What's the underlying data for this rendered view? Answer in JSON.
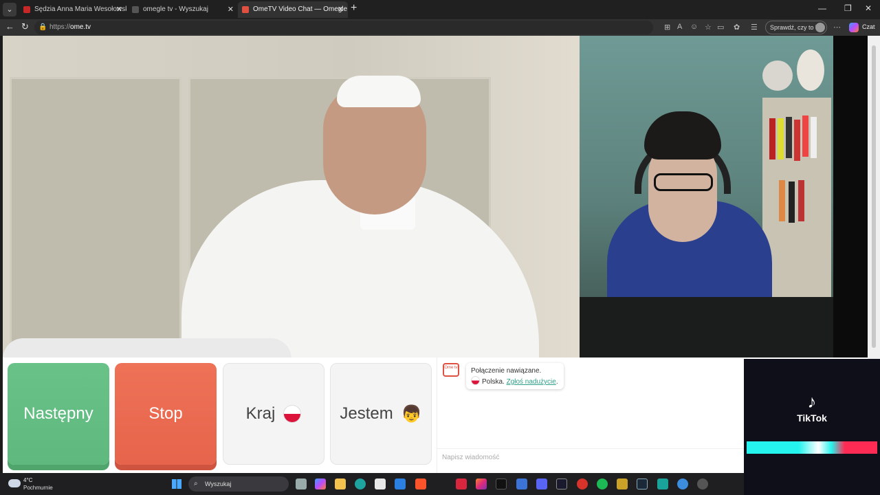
{
  "browser": {
    "tabs": [
      {
        "title": "Sędzia Anna Maria Wesołowska o",
        "active": false,
        "color": "#c62828"
      },
      {
        "title": "omegle tv - Wyszukaj",
        "active": false,
        "color": "#888888"
      },
      {
        "title": "OmeTV Video Chat — Omegle",
        "active": true,
        "color": "#e05040"
      }
    ],
    "address_prefix": "https://",
    "address_domain": "ome.tv",
    "profile_label": "Sprawdź, czy to Ty",
    "chat_label": "Czat"
  },
  "controls": {
    "next_label": "Następny",
    "stop_label": "Stop",
    "country_label": "Kraj",
    "gender_label": "Jestem",
    "next_color": "#69c288",
    "stop_color": "#ee7257"
  },
  "chat": {
    "logo_text": "Ome tv",
    "status": "Połączenie nawiązane.",
    "country": "Polska.",
    "report_link": "Zgłoś nadużycie",
    "report_suffix": ".",
    "input_placeholder": "Napisz wiadomość"
  },
  "tiktok": {
    "name": "TikTok"
  },
  "taskbar": {
    "temperature": "4°C",
    "weather": "Pochmurnie",
    "search_placeholder": "Wyszukaj"
  }
}
